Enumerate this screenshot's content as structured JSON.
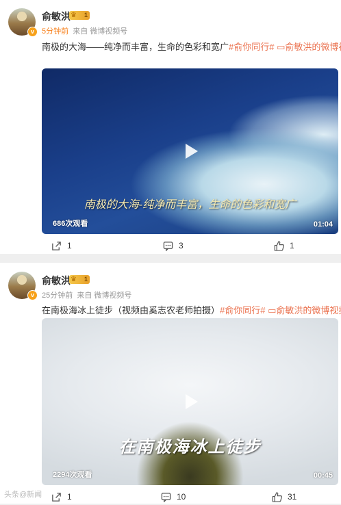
{
  "posts": [
    {
      "author": "俞敏洪",
      "level": "1",
      "time": "5分钟前",
      "source_prefix": "来自",
      "source": "微博视频号",
      "text_main": "南极的大海——纯净而丰富，生命的色彩和宽广",
      "tag": "#俞你同行#",
      "link_icon": "video-link-icon",
      "link_text": "俞敏洪的微博视频",
      "video": {
        "subtitle": "南极的大海-纯净而丰富，生命的色彩和宽广",
        "views": "686次观看",
        "duration": "01:04"
      },
      "actions": {
        "share": "1",
        "comment": "3",
        "like": "1"
      }
    },
    {
      "author": "俞敏洪",
      "level": "1",
      "time": "25分钟前",
      "source_prefix": "来自",
      "source": "微博视频号",
      "text_main": "在南极海冰上徒步（视频由奚志农老师拍摄）",
      "tag": "#俞你同行#",
      "link_icon": "video-link-icon",
      "link_text": "俞敏洪的微博视频",
      "video": {
        "subtitle": "在南极海冰上徒步",
        "views": "2294次观看",
        "duration": "00:45"
      },
      "actions": {
        "share": "1",
        "comment": "10",
        "like": "31"
      }
    }
  ],
  "watermark": "头条@新闻",
  "colors": {
    "tag": "#eb7350",
    "time": "#f7821e",
    "background": "#efefef"
  }
}
